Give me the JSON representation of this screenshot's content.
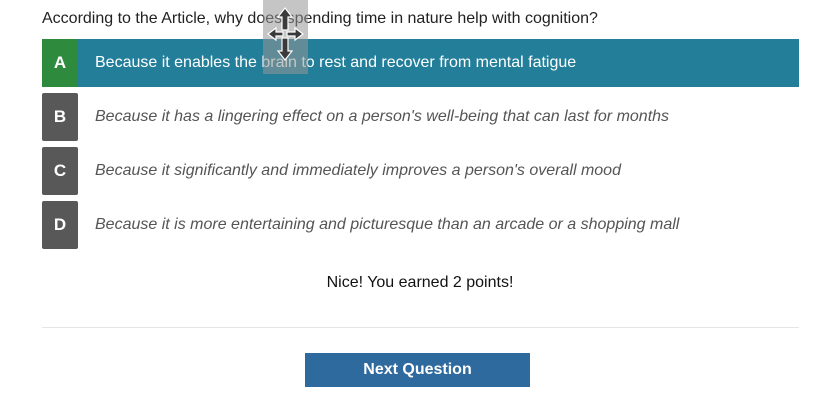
{
  "question": {
    "text": "According to the Article, why does spending time in nature help with cognition?"
  },
  "options": [
    {
      "letter": "A",
      "text": "Because it enables the brain to rest and recover from mental fatigue",
      "state": "correct-selected"
    },
    {
      "letter": "B",
      "text": "Because it has a lingering effect on a person's well-being that can last for months",
      "state": "unselected"
    },
    {
      "letter": "C",
      "text": "Because it significantly and immediately improves a person's overall mood",
      "state": "unselected"
    },
    {
      "letter": "D",
      "text": "Because it is more entertaining and picturesque than an arcade or a shopping mall",
      "state": "unselected"
    }
  ],
  "feedback": {
    "text": "Nice! You earned 2 points!"
  },
  "next_button": {
    "label": "Next Question"
  },
  "overlay": {
    "icon": "move-cursor-icon"
  },
  "colors": {
    "selected_bg": "#237e9a",
    "correct_badge": "#2e8b3e",
    "letter_badge": "#585858",
    "button_bg": "#2f6a9f"
  }
}
